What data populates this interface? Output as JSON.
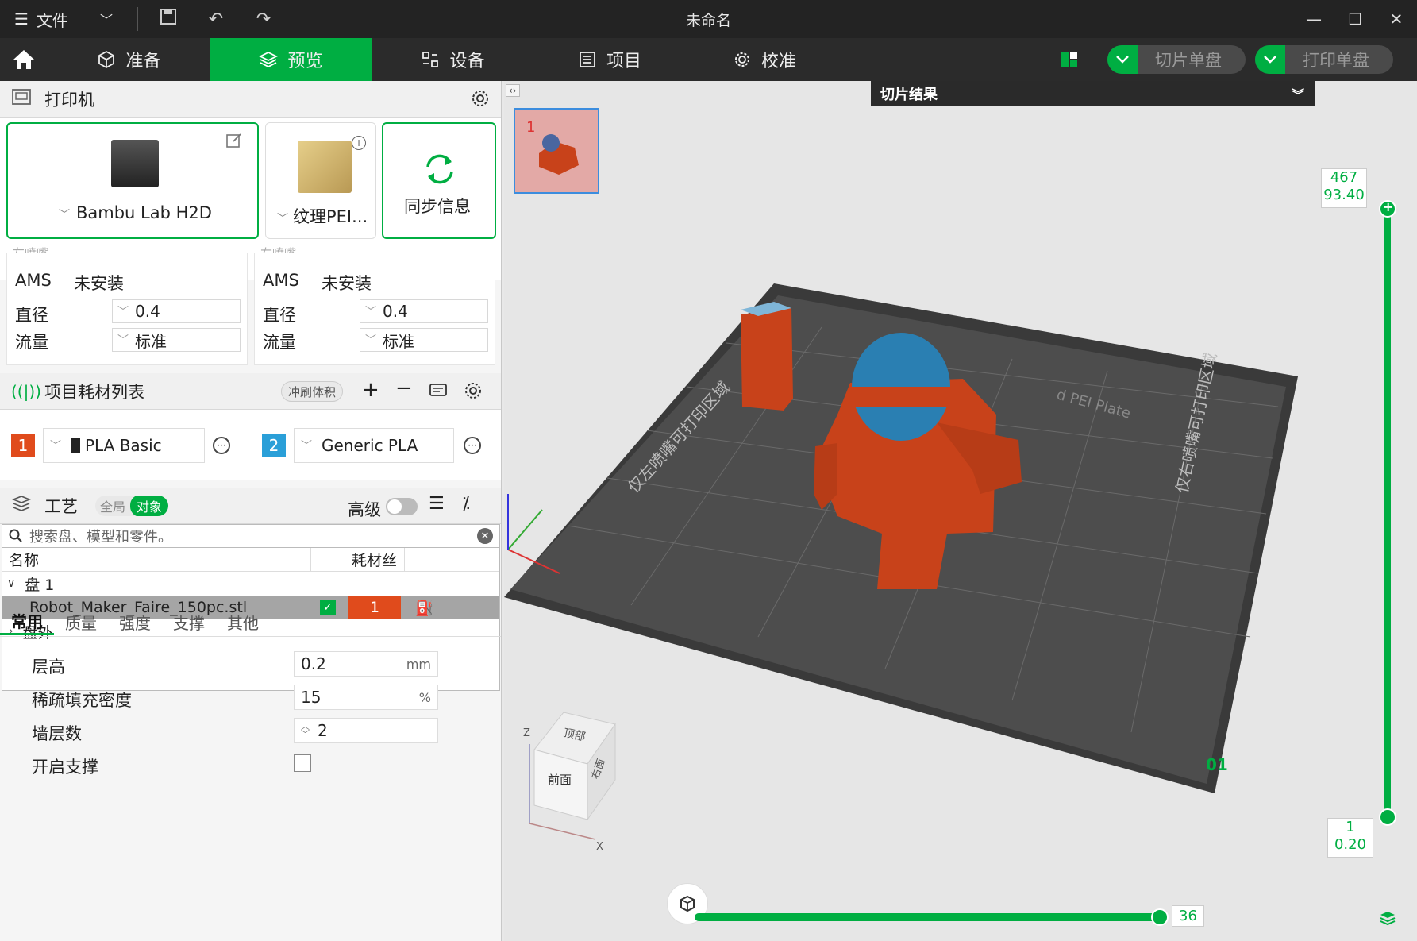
{
  "titlebar": {
    "menu_label": "文件",
    "window_title": "未命名"
  },
  "toolbar": {
    "tabs": [
      {
        "label": "准备"
      },
      {
        "label": "预览"
      },
      {
        "label": "设备"
      },
      {
        "label": "项目"
      },
      {
        "label": "校准"
      }
    ],
    "slice_plate": "切片单盘",
    "print_plate": "打印单盘",
    "accent": "#00ae42"
  },
  "printer_section": {
    "title": "打印机",
    "printer_name": "Bambu Lab H2D",
    "plate_name": "纹理PEI...",
    "sync_label": "同步信息"
  },
  "nozzles": {
    "left": {
      "title": "左喷嘴",
      "ams_label": "AMS",
      "ams_value": "未安装",
      "diameter_label": "直径",
      "diameter_value": "0.4",
      "flow_label": "流量",
      "flow_value": "标准"
    },
    "right": {
      "title": "右喷嘴",
      "ams_label": "AMS",
      "ams_value": "未安装",
      "diameter_label": "直径",
      "diameter_value": "0.4",
      "flow_label": "流量",
      "flow_value": "标准"
    }
  },
  "filaments": {
    "title": "项目耗材列表",
    "flush_label": "冲刷体积",
    "items": [
      {
        "index": "1",
        "name": "PLA Basic",
        "color": "#e04b1c"
      },
      {
        "index": "2",
        "name": "Generic PLA",
        "color": "#2a9fd8"
      }
    ]
  },
  "process": {
    "title": "工艺",
    "scope_global": "全局",
    "scope_object": "对象",
    "advanced_label": "高级",
    "search_placeholder": "搜索盘、模型和零件。",
    "col_name": "名称",
    "col_filament": "耗材丝",
    "plate_row": "盘 1",
    "object_row": "Robot_Maker_Faire_150pc.stl",
    "object_filament": "1",
    "offplate_row": "盘外"
  },
  "param_tabs": [
    "常用",
    "质量",
    "强度",
    "支撑",
    "其他"
  ],
  "params": {
    "layer_height_label": "层高",
    "layer_height_value": "0.2",
    "layer_height_unit": "mm",
    "infill_label": "稀疏填充密度",
    "infill_value": "15",
    "infill_unit": "%",
    "walls_label": "墙层数",
    "walls_value": "2",
    "support_label": "开启支撑"
  },
  "viewport": {
    "slice_result_title": "切片结果",
    "thumb_index": "1",
    "layer_top": "467",
    "layer_top_height": "93.40",
    "layer_bottom": "1",
    "layer_bottom_height": "0.20",
    "move_value": "36",
    "plate_text_1": "仅左喷嘴可打印区域",
    "plate_text_2": "仅右喷嘴可打印区域",
    "plate_brand": "d PEI Plate",
    "plate_number": "01",
    "cube_top": "顶部",
    "cube_front": "前面",
    "cube_right": "右面",
    "axis_z": "Z",
    "axis_x": "X",
    "model_color": "#c8421a",
    "dome_color": "#2a7fb2"
  }
}
